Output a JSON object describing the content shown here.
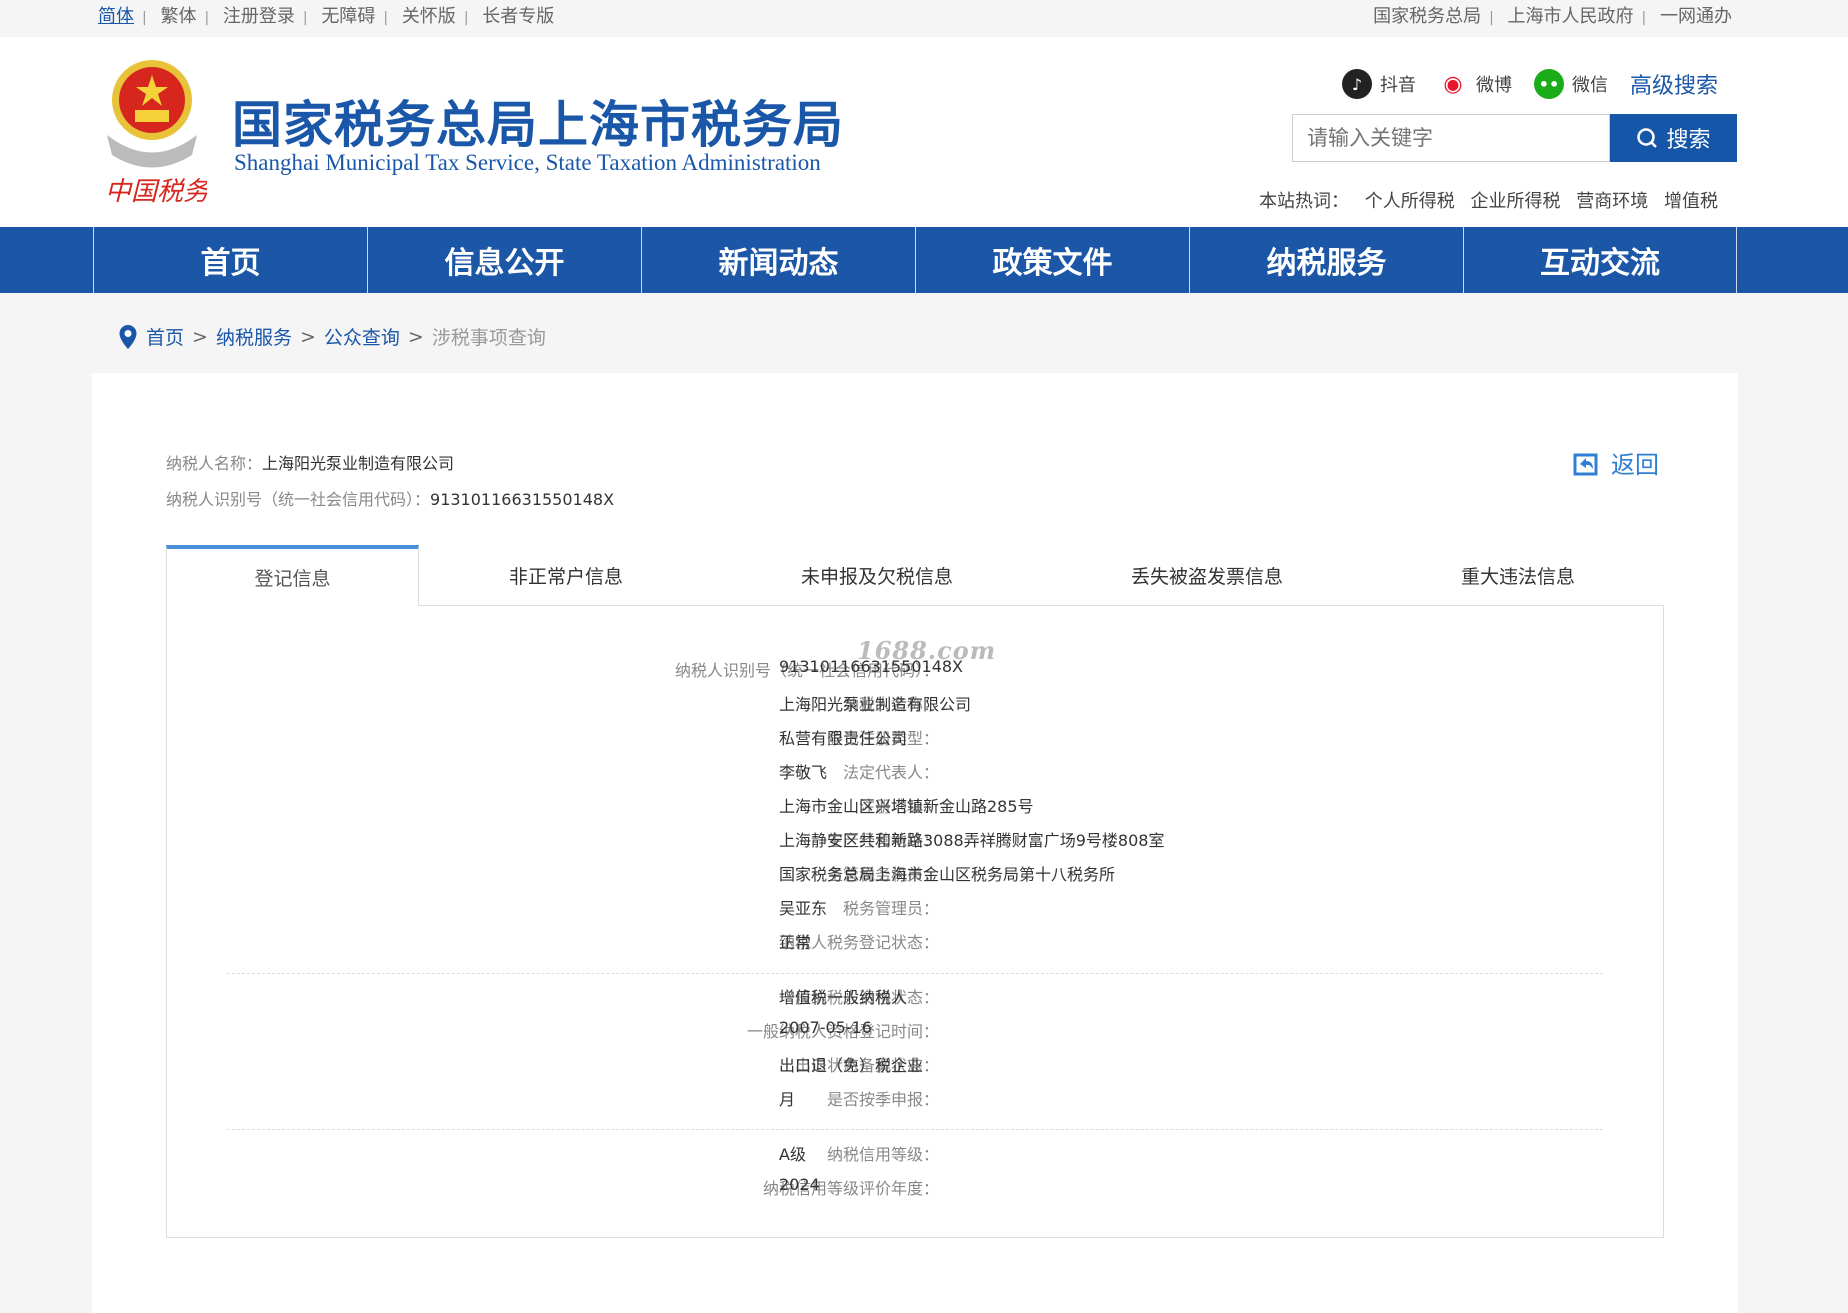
{
  "topbar": {
    "left": [
      "简体",
      "繁体",
      "注册登录",
      "无障碍",
      "关怀版",
      "长者专版"
    ],
    "right": [
      "国家税务总局",
      "上海市人民政府",
      "一网通办"
    ]
  },
  "header": {
    "title": "国家税务总局上海市税务局",
    "subtitle": "Shanghai Municipal Tax Service, State Taxation Administration",
    "logo_text": "中国税务",
    "social": [
      {
        "label": "抖音",
        "icon": "douyin-icon",
        "color": "#222222"
      },
      {
        "label": "微博",
        "icon": "weibo-icon",
        "color": "#e6162d"
      },
      {
        "label": "微信",
        "icon": "wechat-icon",
        "color": "#1aad19"
      }
    ],
    "advanced_search": "高级搜索",
    "search_placeholder": "请输入关键字",
    "search_button": "搜索",
    "hot_label": "本站热词：",
    "hot_words": [
      "个人所得税",
      "企业所得税",
      "营商环境",
      "增值税"
    ]
  },
  "nav": [
    "首页",
    "信息公开",
    "新闻动态",
    "政策文件",
    "纳税服务",
    "互动交流"
  ],
  "breadcrumb": {
    "items": [
      "首页",
      "纳税服务",
      "公众查询"
    ],
    "current": "涉税事项查询",
    "sep": ">"
  },
  "summary": {
    "name_label": "纳税人名称：",
    "name": "上海阳光泵业制造有限公司",
    "id_label": "纳税人识别号（统一社会信用代码）：",
    "id": "91310116631550148X",
    "back": "返回"
  },
  "tabs": [
    "登记信息",
    "非正常户信息",
    "未申报及欠税信息",
    "丢失被盗发票信息",
    "重大违法信息"
  ],
  "watermark": "1688.com",
  "groups": [
    [
      {
        "label": "纳税人识别号（统一社会信用代码）：",
        "value": "91310116631550148X"
      },
      {
        "label": "纳税人名称：",
        "value": "上海阳光泵业制造有限公司"
      },
      {
        "label": "登记注册类型：",
        "value": "私营有限责任公司"
      },
      {
        "label": "法定代表人：",
        "value": "李敬飞"
      },
      {
        "label": "注册地址：",
        "value": "上海市金山区兴塔镇新金山路285号"
      },
      {
        "label": "生产经营地址：",
        "value": "上海静安区共和新路3088弄祥腾财富广场9号楼808室"
      },
      {
        "label": "主管税务机关：",
        "value": "国家税务总局上海市金山区税务局第十八税务所"
      },
      {
        "label": "税务管理员：",
        "value": "吴亚东"
      },
      {
        "label": "纳税人税务登记状态：",
        "value": "正常"
      }
    ],
    [
      {
        "label": "一般纳税人资格状态：",
        "value": "增值税一般纳税人"
      },
      {
        "label": "一般纳税人资格登记时间：",
        "value": "2007-05-16"
      },
      {
        "label": "出口状态备案状态：",
        "value": "出口退（免）税企业"
      },
      {
        "label": "是否按季申报：",
        "value": "月"
      }
    ],
    [
      {
        "label": "纳税信用等级：",
        "value": "A级"
      },
      {
        "label": "纳税信用等级评价年度：",
        "value": "2024"
      }
    ]
  ]
}
